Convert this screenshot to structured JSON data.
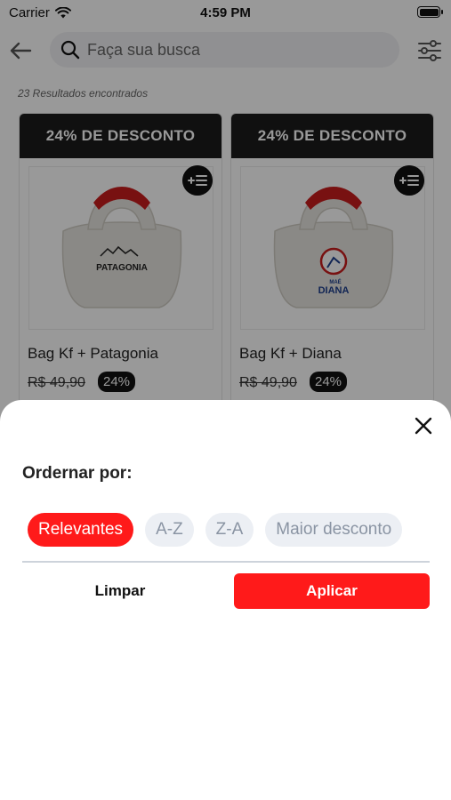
{
  "status_bar": {
    "carrier": "Carrier",
    "time": "4:59 PM"
  },
  "search": {
    "placeholder": "Faça sua busca"
  },
  "results": {
    "count_text": "23 Resultados encontrados"
  },
  "products": [
    {
      "banner": "24% DE DESCONTO",
      "name": "Bag Kf + Patagonia",
      "price": "R$ 49,90",
      "discount": "24%",
      "logo_text": "PATAGONIA"
    },
    {
      "banner": "24% DE DESCONTO",
      "name": "Bag Kf + Diana",
      "price": "R$ 49,90",
      "discount": "24%",
      "logo_text": "DIANA",
      "logo_subtext": "MAÉ"
    }
  ],
  "sort_sheet": {
    "title": "Ordernar por:",
    "options": [
      "Relevantes",
      "A-Z",
      "Z-A",
      "Maior desconto"
    ],
    "selected": "Relevantes",
    "clear_label": "Limpar",
    "apply_label": "Aplicar"
  },
  "colors": {
    "accent": "#ff1a1a",
    "banner": "#1b1b1b",
    "chip_bg": "#eceff4"
  },
  "icons": {
    "back": "arrow-left-icon",
    "search": "magnifier-icon",
    "filter": "sliders-icon",
    "add_list": "playlist-add-icon",
    "close": "close-icon"
  }
}
